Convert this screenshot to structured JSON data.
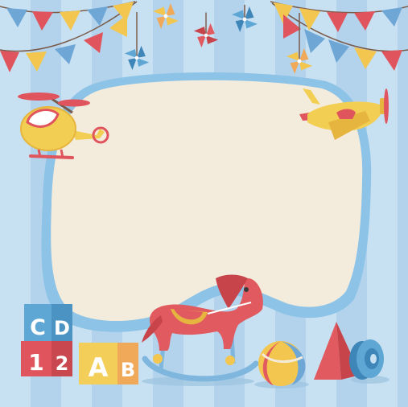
{
  "background": {
    "stripe_light": "#c7e0f2",
    "stripe_dark": "#b3d3ec",
    "frame_border": "#8cc3e6",
    "frame_fill": "#f3ecdd"
  },
  "blocks": {
    "top_row": [
      "C",
      "D"
    ],
    "middle_row": [
      "1",
      "2"
    ],
    "front_row": [
      "A",
      "B"
    ]
  },
  "colors": {
    "bunting_red": "#e0555d",
    "bunting_yellow": "#f3c64f",
    "bunting_blue": "#6ea6d6",
    "horse_red": "#e05a5f",
    "rocker_blue": "#7fb6de",
    "toy_yellow": "#f2cf53"
  },
  "icons": [
    "bunting-icon",
    "pinwheel-icon",
    "helicopter-icon",
    "airplane-icon",
    "rocking-horse-icon",
    "beach-ball-icon",
    "pyramid-icon",
    "toy-wheel-icon",
    "alphabet-blocks-icon"
  ]
}
